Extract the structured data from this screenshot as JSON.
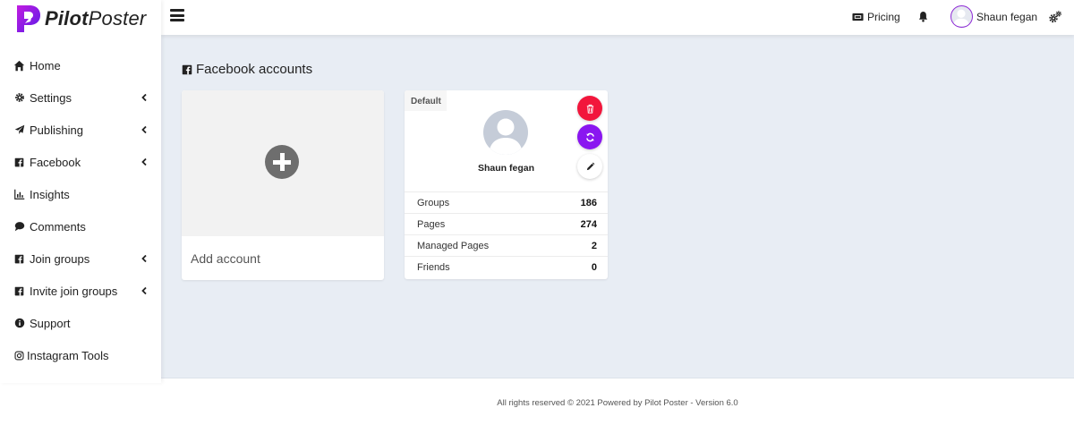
{
  "brand": {
    "name_bold": "Pilot",
    "name_rest": "Poster",
    "accent": "#8e2bd6"
  },
  "sidebar": {
    "items": [
      {
        "label": "Home",
        "icon": "home-icon",
        "has_chevron": false
      },
      {
        "label": "Settings",
        "icon": "cog-icon",
        "has_chevron": true
      },
      {
        "label": "Publishing",
        "icon": "paper-plane-icon",
        "has_chevron": true
      },
      {
        "label": "Facebook",
        "icon": "facebook-square-icon",
        "has_chevron": true
      },
      {
        "label": "Insights",
        "icon": "chart-bar-icon",
        "has_chevron": false
      },
      {
        "label": "Comments",
        "icon": "comment-icon",
        "has_chevron": false
      },
      {
        "label": "Join groups",
        "icon": "facebook-square-icon",
        "has_chevron": true
      },
      {
        "label": "Invite join groups",
        "icon": "facebook-square-icon",
        "has_chevron": true
      },
      {
        "label": "Support",
        "icon": "info-circle-icon",
        "has_chevron": false
      },
      {
        "label": "Instagram Tools",
        "icon": "instagram-icon",
        "has_chevron": false
      }
    ]
  },
  "topbar": {
    "pricing_label": "Pricing",
    "user_name": "Shaun fegan"
  },
  "main": {
    "title": "Facebook accounts",
    "add_account_label": "Add account",
    "account": {
      "badge": "Default",
      "name": "Shaun fegan",
      "stats": [
        {
          "label": "Groups",
          "value": "186"
        },
        {
          "label": "Pages",
          "value": "274"
        },
        {
          "label": "Managed Pages",
          "value": "2"
        },
        {
          "label": "Friends",
          "value": "0"
        }
      ],
      "colors": {
        "delete": "#f2163c",
        "sync": "#8a16f0"
      }
    }
  },
  "footer": {
    "text": "All rights reserved © 2021 Powered by Pilot Poster - Version 6.0"
  }
}
